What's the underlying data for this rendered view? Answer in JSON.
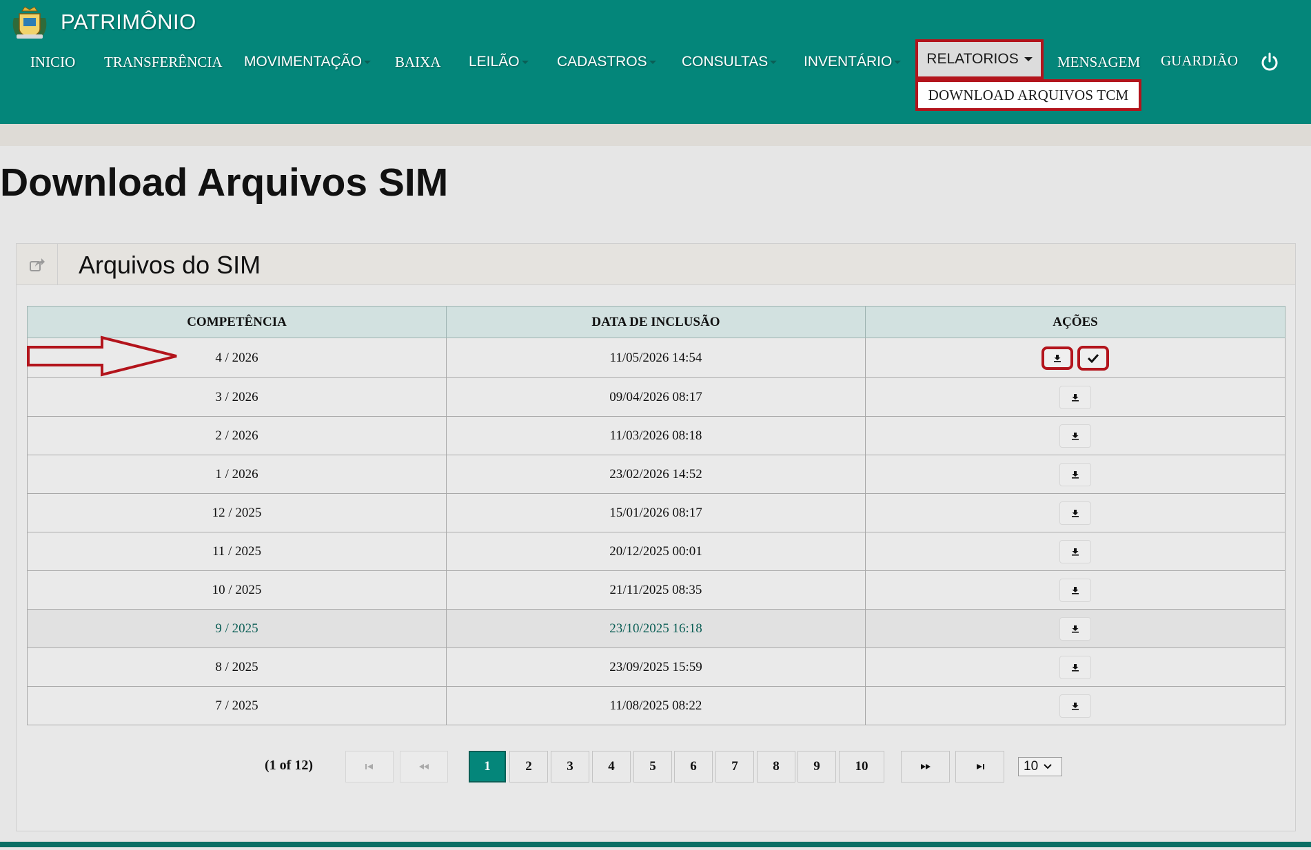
{
  "app": {
    "title": "PATRIMÔNIO"
  },
  "nav": {
    "items": [
      {
        "label": "INICIO"
      },
      {
        "label": "TRANSFERÊNCIA"
      },
      {
        "label": "MOVIMENTAÇÃO"
      },
      {
        "label": "BAIXA"
      },
      {
        "label": "LEILÃO"
      },
      {
        "label": "CADASTROS"
      },
      {
        "label": "CONSULTAS"
      },
      {
        "label": "INVENTÁRIO"
      },
      {
        "label": "RELATORIOS"
      },
      {
        "label": "MENSAGEM"
      },
      {
        "label": "GUARDIÃO"
      }
    ],
    "dropdown_item": "DOWNLOAD ARQUIVOS TCM"
  },
  "page": {
    "title": "Download Arquivos SIM"
  },
  "panel": {
    "title": "Arquivos do SIM"
  },
  "table": {
    "headers": [
      "COMPETÊNCIA",
      "DATA DE INCLUSÃO",
      "AÇÕES"
    ],
    "rows": [
      {
        "competencia": "4 / 2026",
        "data": "11/05/2026 14:54"
      },
      {
        "competencia": "3 / 2026",
        "data": "09/04/2026 08:17"
      },
      {
        "competencia": "2 / 2026",
        "data": "11/03/2026 08:18"
      },
      {
        "competencia": "1 / 2026",
        "data": "23/02/2026 14:52"
      },
      {
        "competencia": "12 / 2025",
        "data": "15/01/2026 08:17"
      },
      {
        "competencia": "11 / 2025",
        "data": "20/12/2025 00:01"
      },
      {
        "competencia": "10 / 2025",
        "data": "21/11/2025 08:35"
      },
      {
        "competencia": "9 / 2025",
        "data": "23/10/2025 16:18"
      },
      {
        "competencia": "8 / 2025",
        "data": "23/09/2025 15:59"
      },
      {
        "competencia": "7 / 2025",
        "data": "11/08/2025 08:22"
      }
    ]
  },
  "pagination": {
    "info": "(1 of 12)",
    "pages": [
      "1",
      "2",
      "3",
      "4",
      "5",
      "6",
      "7",
      "8",
      "9",
      "10"
    ],
    "current": "1",
    "rows_per_page": "10"
  },
  "colors": {
    "navbar": "#04867a",
    "accent_red": "#b3141c",
    "header_row": "#d2e1e0"
  },
  "icons": [
    "logo-crest",
    "caret-down-icon",
    "power-icon",
    "share-icon",
    "download-icon",
    "check-icon",
    "first-page-icon",
    "prev-page-icon",
    "next-page-icon",
    "last-page-icon",
    "red-arrow"
  ]
}
